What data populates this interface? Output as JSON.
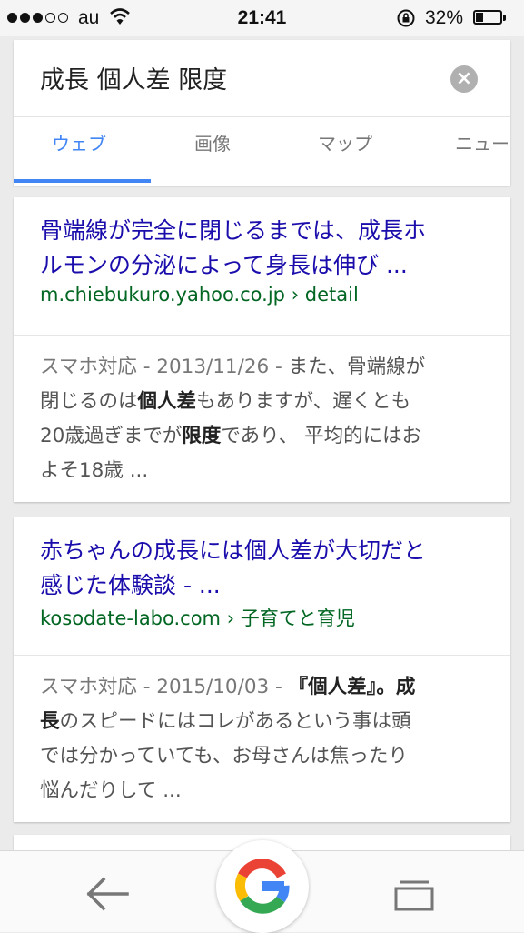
{
  "status": {
    "carrier": "au",
    "time": "21:41",
    "battery_pct": "32%",
    "battery_level": 0.32,
    "signal_bars": 3,
    "signal_total": 5
  },
  "search": {
    "query": "成長 個人差 限度",
    "clear_icon": "clear-circle-icon",
    "tabs": [
      {
        "label": "ウェブ",
        "active": true
      },
      {
        "label": "画像",
        "active": false
      },
      {
        "label": "マップ",
        "active": false
      },
      {
        "label": "ニュー",
        "active": false
      }
    ]
  },
  "results": [
    {
      "title_line1": "骨端線が完全に閉じるまでは、成長ホ",
      "title_line2": "ルモンの分泌によって身長は伸び ...",
      "url": "m.chiebukuro.yahoo.co.jp",
      "url_path": " › detail",
      "meta": "スマホ対応 - 2013/11/26 - ",
      "s1": "また、骨端線が",
      "s2": "閉じるのは",
      "b1": "個人差",
      "s3": "もありますが、遅くとも",
      "s4": "20歳過ぎまでが",
      "b2": "限度",
      "s5": "であり、 平均的にはお",
      "s6": "よそ18歳 ..."
    },
    {
      "title_line1": "赤ちゃんの成長には個人差が大切だと",
      "title_line2": "感じた体験談 - ...",
      "url": "kosodate-labo.com",
      "url_path": " › 子育てと育児",
      "meta": "スマホ対応 - 2015/10/03 - ",
      "b1": "『個人差』。成",
      "b2": "長",
      "s1": "のスピードにはコレがあるという事は頭",
      "s2": "では分かっていても、お母さんは焦ったり",
      "s3": "悩んだりして ..."
    }
  ],
  "nav": {
    "back_icon": "back-arrow-icon",
    "google_icon": "google-g-icon",
    "tabs_icon": "tabs-icon"
  },
  "colors": {
    "link": "#1a0dab",
    "url": "#006621",
    "accent": "#4285f4"
  }
}
